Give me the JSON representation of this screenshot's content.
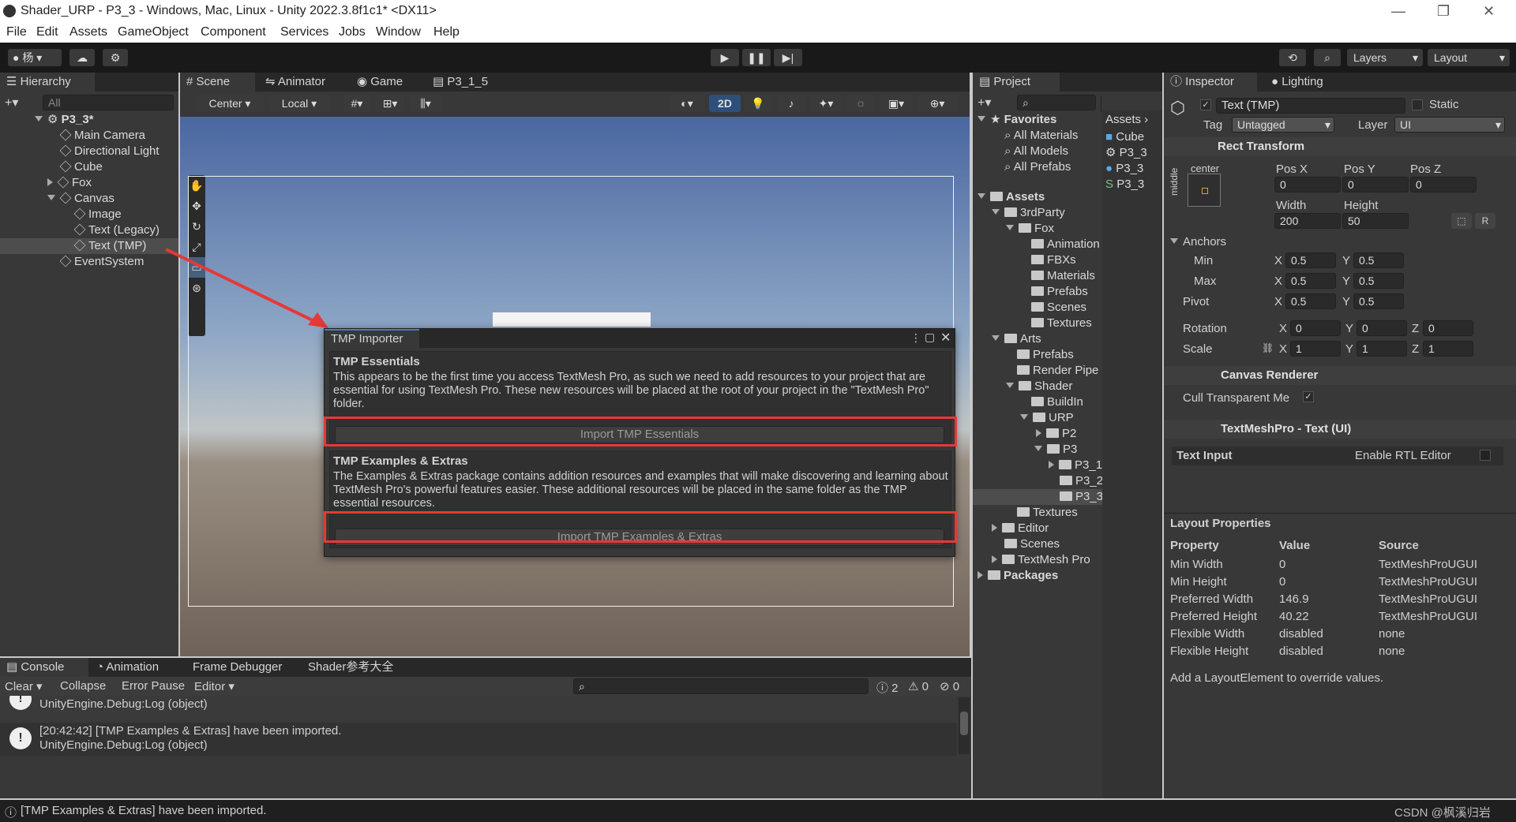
{
  "window": {
    "title": "Shader_URP - P3_3 - Windows, Mac, Linux - Unity 2022.3.8f1c1* <DX11>"
  },
  "menu": [
    "File",
    "Edit",
    "Assets",
    "GameObject",
    "Component",
    "Services",
    "Jobs",
    "Window",
    "Help"
  ],
  "toolbar": {
    "account": "杨",
    "layers": "Layers",
    "layout": "Layout"
  },
  "hierarchy": {
    "tab": "Hierarchy",
    "search_placeholder": "All",
    "scene": "P3_3*",
    "items": [
      "Main Camera",
      "Directional Light",
      "Cube",
      "Fox",
      "Canvas",
      "Image",
      "Text (Legacy)",
      "Text (TMP)",
      "EventSystem"
    ]
  },
  "scene_tabs": [
    "Scene",
    "Animator",
    "Game",
    "P3_1_5"
  ],
  "scene_toolbar": {
    "pivot": "Center",
    "space": "Local",
    "mode2d": "2D"
  },
  "tmp_importer": {
    "title": "TMP Importer",
    "essentials_title": "TMP Essentials",
    "essentials_text": "This appears to be the first time you access TextMesh Pro, as such we need to add resources to your project that are essential for using TextMesh Pro. These new resources will be placed at the root of your project in the \"TextMesh Pro\" folder.",
    "essentials_button": "Import TMP Essentials",
    "extras_title": "TMP Examples & Extras",
    "extras_text": "The Examples & Extras package contains addition resources and examples that will make discovering and learning about TextMesh Pro's powerful features easier. These additional resources will be placed in the same folder as the TMP essential resources.",
    "extras_button": "Import TMP Examples & Extras"
  },
  "project": {
    "tab": "Project",
    "favorites": "Favorites",
    "fav_items": [
      "All Materials",
      "All Models",
      "All Prefabs"
    ],
    "assets": "Assets",
    "tree": [
      "3rdParty",
      "Fox",
      "Animation",
      "FBXs",
      "Materials",
      "Prefabs",
      "Scenes",
      "Textures",
      "Arts",
      "Prefabs",
      "Render Pipe",
      "Shader",
      "BuildIn",
      "URP",
      "P2",
      "P3",
      "P3_1",
      "P3_2",
      "P3_3",
      "Textures",
      "Editor",
      "Scenes",
      "TextMesh Pro",
      "Packages"
    ],
    "breadcrumb": "Assets",
    "files": [
      "Cube",
      "P3_3",
      "P3_3",
      "P3_3"
    ]
  },
  "inspector": {
    "tab": "Inspector",
    "tab2": "Lighting",
    "object_name": "Text (TMP)",
    "static": "Static",
    "tag_label": "Tag",
    "tag": "Untagged",
    "layer_label": "Layer",
    "layer": "UI",
    "rect_transform": "Rect Transform",
    "anchor_h": "center",
    "anchor_v": "middle",
    "pos_x_label": "Pos X",
    "pos_y_label": "Pos Y",
    "pos_z_label": "Pos Z",
    "pos_x": "0",
    "pos_y": "0",
    "pos_z": "0",
    "width_label": "Width",
    "height_label": "Height",
    "width": "200",
    "height": "50",
    "anchors": "Anchors",
    "min": "Min",
    "max": "Max",
    "pivot": "Pivot",
    "min_x": "0.5",
    "min_y": "0.5",
    "max_x": "0.5",
    "max_y": "0.5",
    "pivot_x": "0.5",
    "pivot_y": "0.5",
    "rotation": "Rotation",
    "scale": "Scale",
    "rot_x": "0",
    "rot_y": "0",
    "rot_z": "0",
    "scale_x": "1",
    "scale_y": "1",
    "scale_z": "1",
    "canvas_renderer": "Canvas Renderer",
    "cull": "Cull Transparent Me",
    "tmp_component": "TextMeshPro - Text (UI)",
    "text_input": "Text Input",
    "rtl": "Enable RTL Editor"
  },
  "layout_props": {
    "title": "Layout Properties",
    "headers": [
      "Property",
      "Value",
      "Source"
    ],
    "rows": [
      [
        "Min Width",
        "0",
        "TextMeshProUGUI"
      ],
      [
        "Min Height",
        "0",
        "TextMeshProUGUI"
      ],
      [
        "Preferred Width",
        "146.9",
        "TextMeshProUGUI"
      ],
      [
        "Preferred Height",
        "40.22",
        "TextMeshProUGUI"
      ],
      [
        "Flexible Width",
        "disabled",
        "none"
      ],
      [
        "Flexible Height",
        "disabled",
        "none"
      ]
    ],
    "note": "Add a LayoutElement to override values."
  },
  "console": {
    "tabs": [
      "Console",
      "Animation",
      "Frame Debugger",
      "Shader参考大全"
    ],
    "clear": "Clear",
    "collapse": "Collapse",
    "error_pause": "Error Pause",
    "editor": "Editor",
    "count_log": "2",
    "count_warn": "0",
    "count_err": "0",
    "entries": [
      {
        "line1": "",
        "line2": "UnityEngine.Debug:Log (object)"
      },
      {
        "line1": "[20:42:42] [TMP Examples & Extras] have been imported.",
        "line2": "UnityEngine.Debug:Log (object)"
      }
    ]
  },
  "status": {
    "text": "[TMP Examples & Extras] have been imported.",
    "watermark": "CSDN @枫溪归岩"
  }
}
